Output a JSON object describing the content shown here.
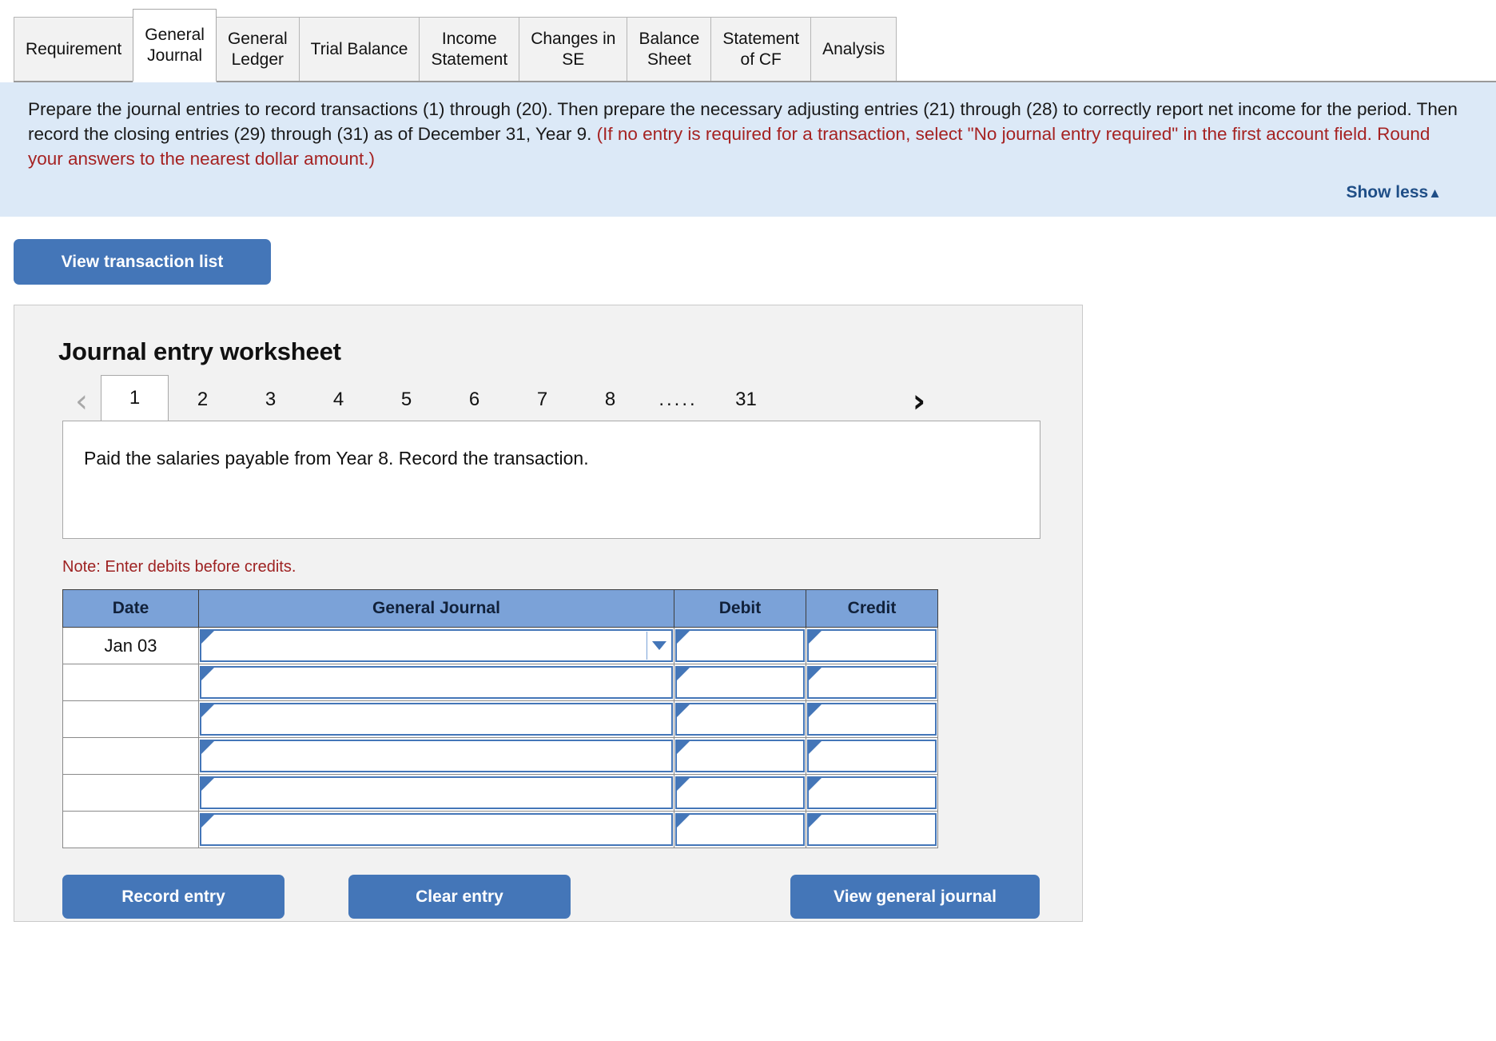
{
  "tabs": [
    {
      "label": "Requirement",
      "active": false
    },
    {
      "label": "General\nJournal",
      "active": true
    },
    {
      "label": "General\nLedger",
      "active": false
    },
    {
      "label": "Trial Balance",
      "active": false
    },
    {
      "label": "Income\nStatement",
      "active": false
    },
    {
      "label": "Changes in\nSE",
      "active": false
    },
    {
      "label": "Balance\nSheet",
      "active": false
    },
    {
      "label": "Statement\nof CF",
      "active": false
    },
    {
      "label": "Analysis",
      "active": false
    }
  ],
  "banner": {
    "text_black_1": "Prepare the journal entries to record transactions (1) through (20). Then prepare the necessary adjusting entries (21) through (28) to correctly report net income for the period. Then record the closing entries (29) through (31) as of December 31, Year 9. ",
    "text_red_1": "(If no entry is required for a transaction, select \"No journal entry required\" in the first account field. Round your answers to the nearest dollar amount.)",
    "show_less_label": "Show less",
    "show_less_caret": "▲",
    "background_color": "#dce9f7",
    "red_color": "#a52222",
    "link_color": "#1f4e87"
  },
  "view_transaction_list_label": "View transaction list",
  "worksheet": {
    "title": "Journal entry worksheet",
    "pager": {
      "prev_icon": "‹",
      "next_icon": "›",
      "pages": [
        "1",
        "2",
        "3",
        "4",
        "5",
        "6",
        "7",
        "8"
      ],
      "ellipsis": ".....",
      "last_page": "31",
      "active_page": "1"
    },
    "description": "Paid the salaries payable from Year 8. Record the transaction.",
    "note": "Note: Enter debits before credits.",
    "table": {
      "headers": [
        "Date",
        "General Journal",
        "Debit",
        "Credit"
      ],
      "rows": [
        {
          "date": "Jan 03",
          "general_journal": "",
          "debit": "",
          "credit": "",
          "has_dropdown": true
        },
        {
          "date": "",
          "general_journal": "",
          "debit": "",
          "credit": "",
          "has_dropdown": false
        },
        {
          "date": "",
          "general_journal": "",
          "debit": "",
          "credit": "",
          "has_dropdown": false
        },
        {
          "date": "",
          "general_journal": "",
          "debit": "",
          "credit": "",
          "has_dropdown": false
        },
        {
          "date": "",
          "general_journal": "",
          "debit": "",
          "credit": "",
          "has_dropdown": false
        },
        {
          "date": "",
          "general_journal": "",
          "debit": "",
          "credit": "",
          "has_dropdown": false
        }
      ],
      "header_color": "#7ba2d8",
      "field_border_color": "#4476b8"
    },
    "buttons": {
      "record_entry": "Record entry",
      "clear_entry": "Clear entry",
      "view_general_journal": "View general journal"
    }
  },
  "theme": {
    "button_blue": "#4476b8",
    "panel_bg": "#f2f2f2"
  }
}
